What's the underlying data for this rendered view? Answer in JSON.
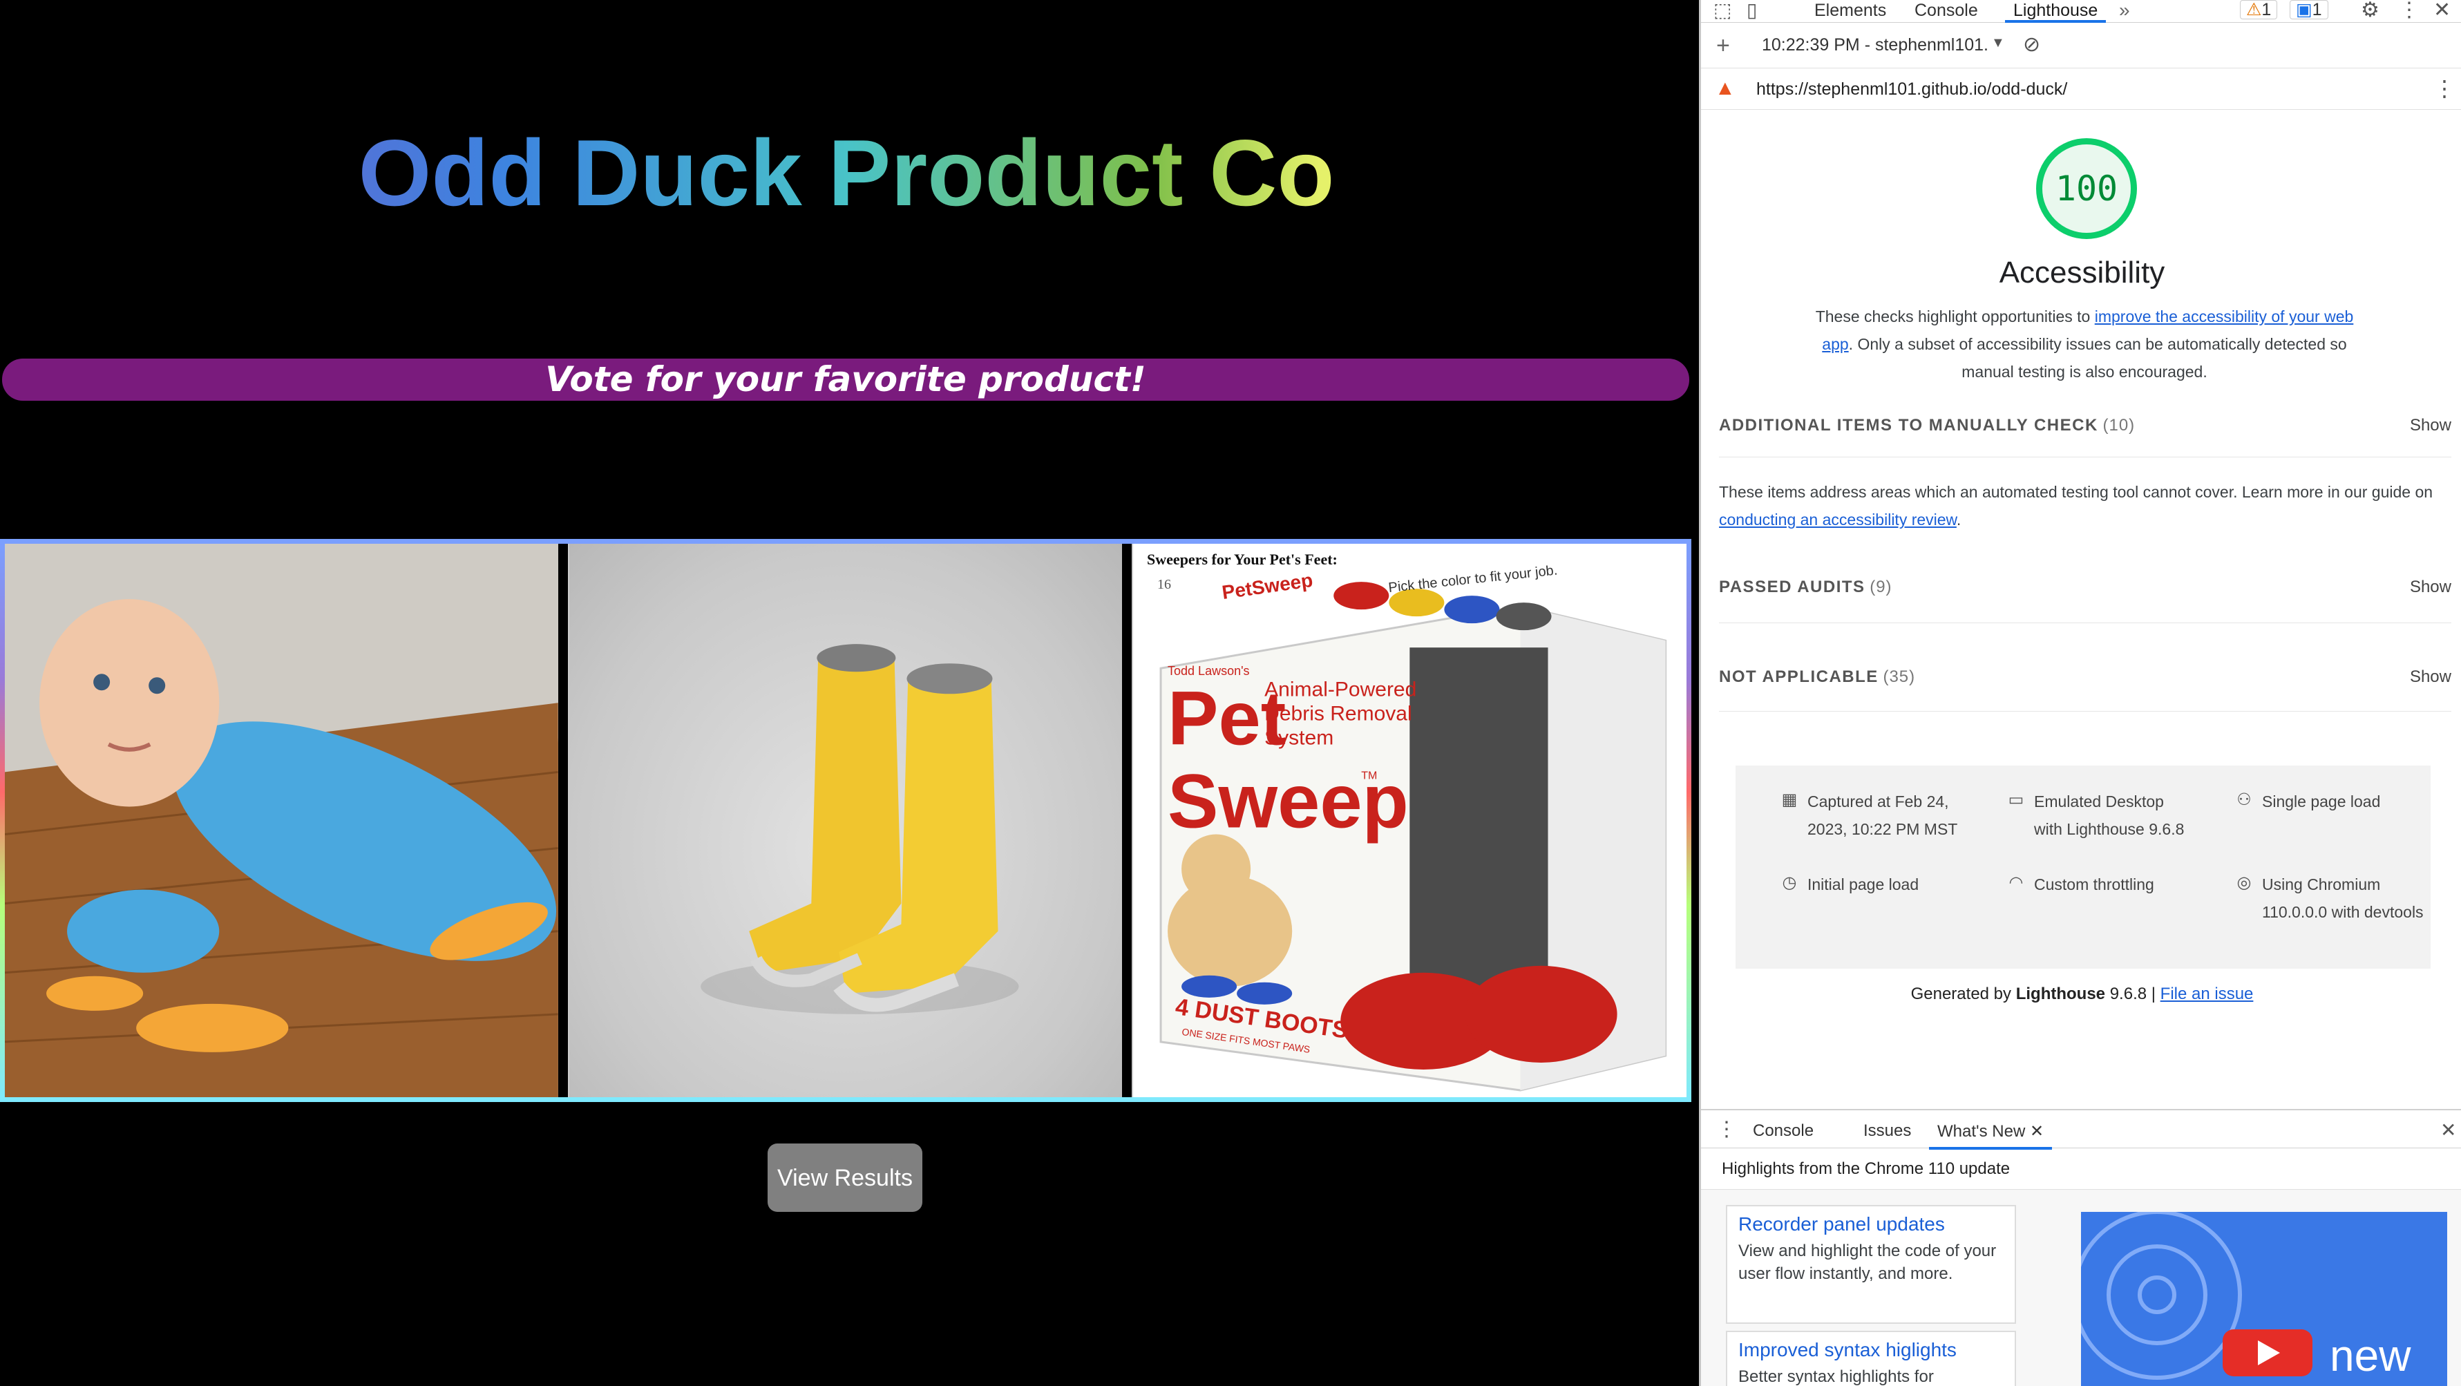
{
  "site": {
    "title": "Odd Duck Product Co",
    "banner": "Vote for your favorite product!",
    "results_button": "View Results",
    "products": [
      {
        "name": "baby-mop-sweeper"
      },
      {
        "name": "yellow-boots"
      },
      {
        "name": "pet-sweep",
        "caption": "Sweepers for Your Pet's Feet:",
        "number": "16",
        "brand_top": "PetSweep",
        "small_brand": "Todd Lawson's",
        "big_1": "Pet",
        "big_2": "Sweep",
        "tm": "TM",
        "side_line_1": "Animal-Powered",
        "side_line_2": "Debris Removal",
        "side_line_3": "System",
        "bottom_1": "4 DUST BOOTS",
        "bottom_2": "ONE SIZE FITS MOST PAWS",
        "slogan": "Pick the color to fit your job."
      }
    ]
  },
  "devtools": {
    "tabs": [
      "Elements",
      "Console",
      "Lighthouse"
    ],
    "active_tab": "Lighthouse",
    "more_tabs": "»",
    "warnings": "1",
    "messages": "1",
    "report_time": "10:22:39 PM - stephenml101.",
    "url": "https://stephenml101.github.io/odd-duck/",
    "score": "100",
    "category": "Accessibility",
    "desc_pre": "These checks highlight opportunities to ",
    "desc_link": "improve the accessibility of your web app",
    "desc_post": ". Only a subset of accessibility issues can be automatically detected so manual testing is also encouraged.",
    "sections": [
      {
        "label": "ADDITIONAL ITEMS TO MANUALLY CHECK",
        "count": "(10)",
        "action": "Show"
      },
      {
        "label": "PASSED AUDITS",
        "count": "(9)",
        "action": "Show"
      },
      {
        "label": "NOT APPLICABLE",
        "count": "(35)",
        "action": "Show"
      }
    ],
    "manual_note_pre": "These items address areas which an automated testing tool cannot cover. Learn more in our guide on ",
    "manual_note_link": "conducting an accessibility review",
    "manual_note_post": ".",
    "meta": {
      "captured": "Captured at Feb 24, 2023, 10:22 PM MST",
      "emulated": "Emulated Desktop with Lighthouse 9.6.8",
      "single": "Single page load",
      "initial": "Initial page load",
      "throttling": "Custom throttling",
      "chromium": "Using Chromium 110.0.0.0 with devtools"
    },
    "generated_pre": "Generated by ",
    "generated_bold": "Lighthouse",
    "generated_ver": " 9.6.8 | ",
    "generated_link": "File an issue",
    "drawer_tabs": [
      "Console",
      "Issues",
      "What's New"
    ],
    "drawer_active": "What's New",
    "highlights_title": "Highlights from the Chrome 110 update",
    "news": [
      {
        "title": "Recorder panel updates",
        "body": "View and highlight the code of your user flow instantly, and more."
      },
      {
        "title": "Improved syntax higlights",
        "body": "Better syntax highlights for"
      }
    ],
    "video_text": "new"
  },
  "colors": {
    "accent": "#1a73e8",
    "banner": "#7a1b7d",
    "score": "#0cce6b"
  }
}
